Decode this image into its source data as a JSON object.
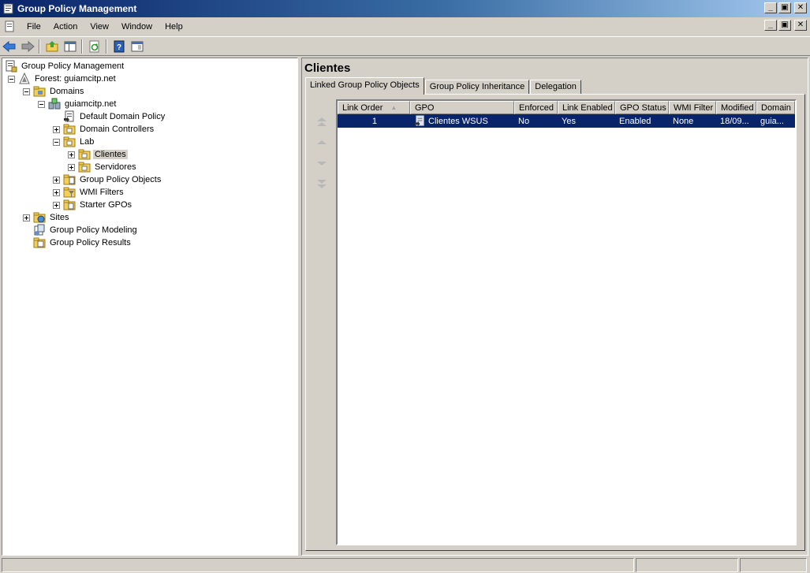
{
  "window": {
    "title": "Group Policy Management",
    "controls": {
      "minimize": "_",
      "restore": "🗗",
      "close": "✕"
    }
  },
  "menu": [
    "File",
    "Action",
    "View",
    "Window",
    "Help"
  ],
  "toolbar": {
    "buttons": [
      "back-arrow-icon",
      "forward-arrow-icon",
      "up-folder-icon",
      "show-hide-tree-icon",
      "refresh-icon",
      "help-icon",
      "console-view-icon"
    ]
  },
  "tree": {
    "root": "Group Policy Management",
    "forest": "Forest: guiamcitp.net",
    "domains": "Domains",
    "domain": "guiamcitp.net",
    "default_policy": "Default Domain Policy",
    "domain_controllers": "Domain Controllers",
    "lab": "Lab",
    "clientes": "Clientes",
    "servidores": "Servidores",
    "gpo_objects": "Group Policy Objects",
    "wmi_filters": "WMI Filters",
    "starter_gpos": "Starter GPOs",
    "sites": "Sites",
    "modeling": "Group Policy Modeling",
    "results": "Group Policy Results"
  },
  "details": {
    "title": "Clientes",
    "tabs": [
      "Linked Group Policy Objects",
      "Group Policy Inheritance",
      "Delegation"
    ],
    "columns": [
      "Link Order",
      "GPO",
      "Enforced",
      "Link Enabled",
      "GPO Status",
      "WMI Filter",
      "Modified",
      "Domain"
    ],
    "rows": [
      {
        "link_order": "1",
        "gpo": "Clientes WSUS",
        "enforced": "No",
        "link_enabled": "Yes",
        "gpo_status": "Enabled",
        "wmi_filter": "None",
        "modified": "18/09...",
        "domain": "guia..."
      }
    ]
  },
  "colors": {
    "selection": "#0a246a",
    "title_start": "#0a246a",
    "title_end": "#a6caf0",
    "face": "#d4d0c8"
  }
}
